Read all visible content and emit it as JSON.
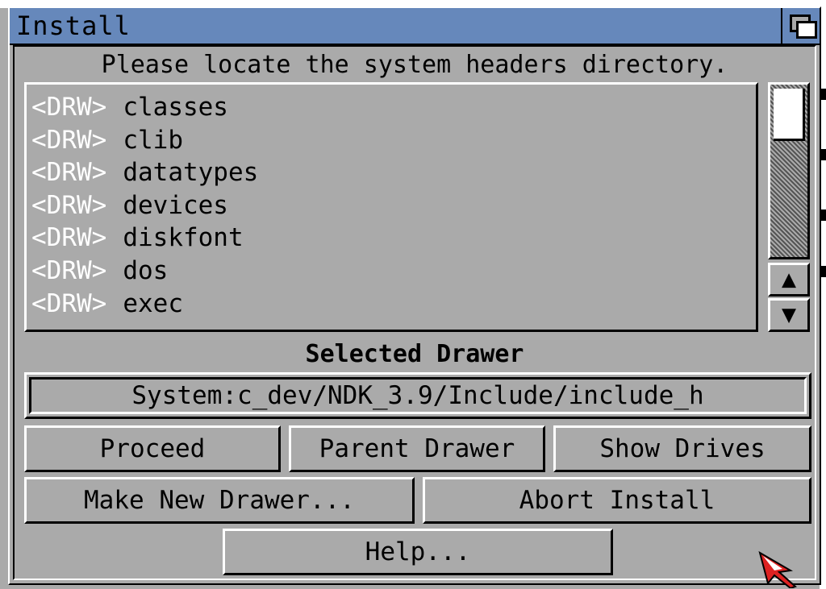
{
  "window": {
    "title": "Install"
  },
  "dialog": {
    "prompt": "Please locate the system headers directory.",
    "list": [
      {
        "tag": "<DRW>",
        "name": "classes"
      },
      {
        "tag": "<DRW>",
        "name": "clib"
      },
      {
        "tag": "<DRW>",
        "name": "datatypes"
      },
      {
        "tag": "<DRW>",
        "name": "devices"
      },
      {
        "tag": "<DRW>",
        "name": "diskfont"
      },
      {
        "tag": "<DRW>",
        "name": "dos"
      },
      {
        "tag": "<DRW>",
        "name": "exec"
      }
    ],
    "scroll_up_glyph": "▲",
    "scroll_down_glyph": "▼",
    "selected_label": "Selected Drawer",
    "selected_path": "System:c_dev/NDK_3.9/Include/include_h"
  },
  "buttons": {
    "proceed": "Proceed",
    "parent_drawer": "Parent Drawer",
    "show_drives": "Show Drives",
    "make_new_drawer": "Make New Drawer...",
    "abort_install": "Abort Install",
    "help": "Help..."
  },
  "colors": {
    "titlebar": "#6688bb",
    "background": "#aaaaaa",
    "highlight": "#ffffff",
    "shadow": "#000000",
    "pointer": "#dd2222"
  },
  "icons": {
    "depth_gadget": "window-depth-icon",
    "pointer": "mouse-pointer-icon"
  }
}
